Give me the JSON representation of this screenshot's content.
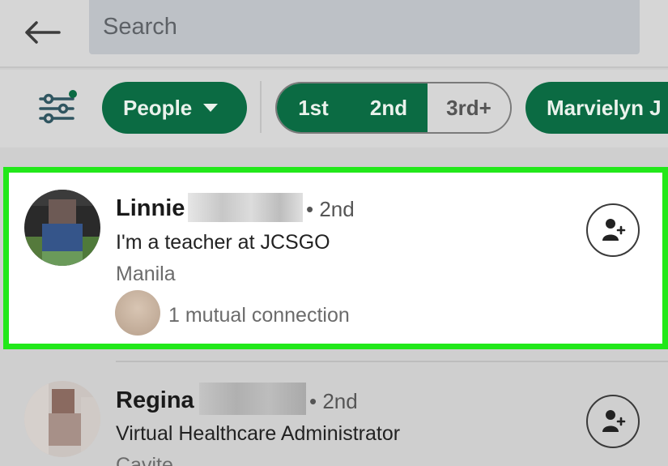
{
  "search": {
    "placeholder": "Search"
  },
  "filters": {
    "people_label": "People",
    "connection_degrees": [
      "1st",
      "2nd",
      "3rd+"
    ],
    "selected_degrees": [
      "1st",
      "2nd"
    ],
    "name_chip": "Marvielyn J"
  },
  "results": [
    {
      "name": "Linnie",
      "degree": "• 2nd",
      "headline": "I'm a teacher at JCSGO",
      "location": "Manila",
      "mutual": "1 mutual connection",
      "highlighted": true
    },
    {
      "name": "Regina",
      "degree": "• 2nd",
      "headline": "Virtual Healthcare Administrator",
      "location": "Cavite",
      "highlighted": false
    }
  ],
  "colors": {
    "accent": "#0b6b43",
    "highlight": "#22e81a"
  },
  "icons": [
    "back-arrow-icon",
    "filter-sliders-icon",
    "add-person-icon"
  ]
}
